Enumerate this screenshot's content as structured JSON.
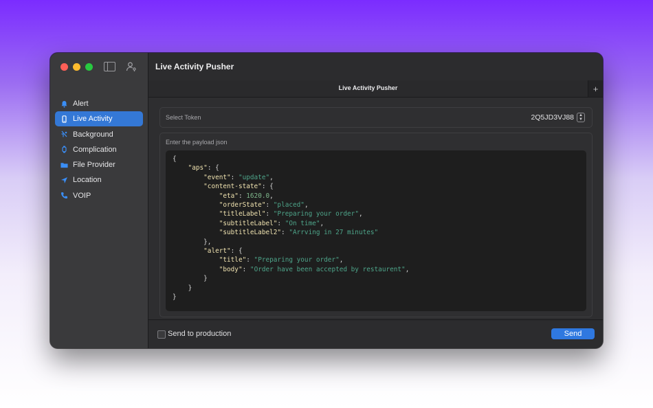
{
  "window": {
    "title": "Live Activity Pusher"
  },
  "sidebar": {
    "items": [
      {
        "label": "Alert",
        "icon": "bell-icon",
        "active": false
      },
      {
        "label": "Live Activity",
        "icon": "phone-icon",
        "active": true
      },
      {
        "label": "Background",
        "icon": "background-icon",
        "active": false
      },
      {
        "label": "Complication",
        "icon": "watch-icon",
        "active": false
      },
      {
        "label": "File Provider",
        "icon": "folder-icon",
        "active": false
      },
      {
        "label": "Location",
        "icon": "location-arrow-icon",
        "active": false
      },
      {
        "label": "VOIP",
        "icon": "phone-call-icon",
        "active": false
      }
    ]
  },
  "tab": {
    "label": "Live Activity Pusher",
    "add": "+"
  },
  "token": {
    "label": "Select Token",
    "value": "2Q5JD3VJ88"
  },
  "payload": {
    "label": "Enter the payload json",
    "json": {
      "aps": {
        "event": "update",
        "content-state": {
          "eta": "1620.0",
          "orderState": "placed",
          "titleLabel": "Preparing your order",
          "subtitleLabel": "On time",
          "subtitleLabel2": "Arrving in 27 minutes"
        },
        "alert": {
          "title": "Preparing your order",
          "body": "Order have been accepted by restaurent"
        }
      }
    }
  },
  "footer": {
    "checkbox_label": "Send to production",
    "send_label": "Send"
  },
  "colors": {
    "accent": "#3478d6",
    "send": "#2f78e0",
    "json_key": "#f0e3b0",
    "json_string": "#4ea58a"
  }
}
